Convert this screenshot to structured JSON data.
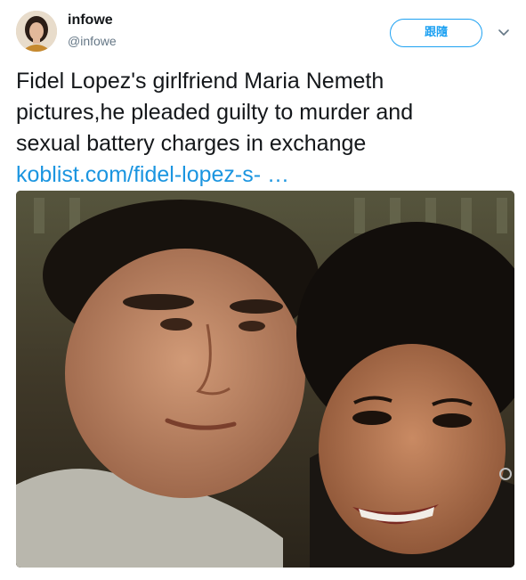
{
  "user": {
    "display_name": "infowe",
    "handle": "@infowe"
  },
  "follow_button": {
    "label": "跟隨"
  },
  "tweet": {
    "lines": [
      "Fidel Lopez's girlfriend Maria Nemeth",
      "pictures,he pleaded guilty to murder and",
      "sexual battery charges in exchange"
    ],
    "link": "koblist.com/fidel-lopez-s- …"
  },
  "colors": {
    "accent": "#1da1f2",
    "link": "#1b95e0",
    "secondary_text": "#657786"
  },
  "icons": {
    "caret": "chevron-down-icon"
  }
}
